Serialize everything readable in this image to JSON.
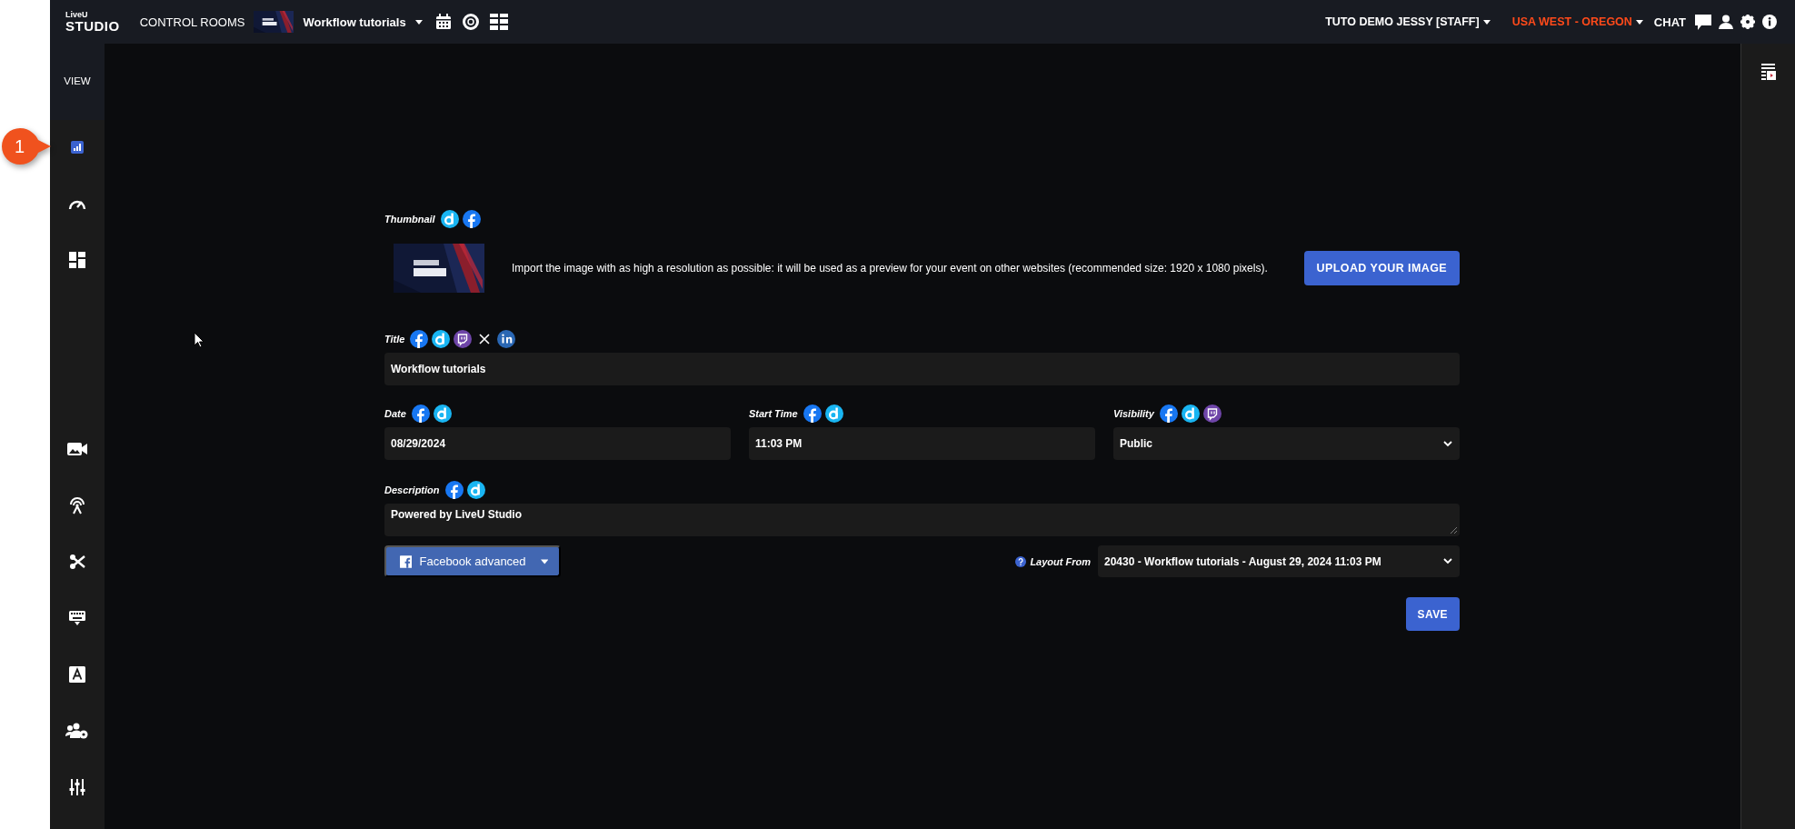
{
  "topbar": {
    "logo": {
      "top": "LiveU",
      "bottom": "STUDIO"
    },
    "nav_link": "CONTROL ROOMS",
    "room": {
      "name": "Workflow tutorials"
    },
    "user": "TUTO DEMO JESSY [STAFF]",
    "region": "USA WEST - OREGON",
    "chat": "CHAT"
  },
  "sidebar": {
    "header": "VIEW",
    "groups": [
      [
        {
          "kind": "chart",
          "selected": true
        },
        {
          "kind": "gauge",
          "selected": false
        },
        {
          "kind": "dashboard",
          "selected": false
        }
      ],
      [
        {
          "kind": "video",
          "selected": false
        },
        {
          "kind": "broadcast",
          "selected": false
        },
        {
          "kind": "scissors",
          "selected": false
        },
        {
          "kind": "keyboard",
          "selected": false
        },
        {
          "kind": "text",
          "selected": false
        },
        {
          "kind": "users",
          "selected": false
        },
        {
          "kind": "sliders",
          "selected": false
        }
      ]
    ]
  },
  "callout": {
    "label": "1"
  },
  "form": {
    "thumbnail": {
      "label": "Thumbnail",
      "platforms": [
        {
          "kind": "dailymotion"
        },
        {
          "kind": "facebook"
        }
      ],
      "hint": "Import the image with as high a resolution as possible: it will be used as a preview for your event on other websites (recommended size: 1920 x 1080 pixels).",
      "button": "UPLOAD YOUR IMAGE"
    },
    "title": {
      "label": "Title",
      "platforms": [
        {
          "kind": "facebook"
        },
        {
          "kind": "dailymotion"
        },
        {
          "kind": "twitch"
        },
        {
          "kind": "x"
        },
        {
          "kind": "linkedin"
        }
      ],
      "value": "Workflow tutorials"
    },
    "date": {
      "label": "Date",
      "platforms": [
        {
          "kind": "facebook"
        },
        {
          "kind": "dailymotion"
        }
      ],
      "value": "08/29/2024"
    },
    "start_time": {
      "label": "Start Time",
      "platforms": [
        {
          "kind": "facebook"
        },
        {
          "kind": "dailymotion"
        }
      ],
      "value": "11:03 PM"
    },
    "visibility": {
      "label": "Visibility",
      "platforms": [
        {
          "kind": "facebook"
        },
        {
          "kind": "dailymotion"
        },
        {
          "kind": "twitch"
        }
      ],
      "value": "Public"
    },
    "description": {
      "label": "Description",
      "platforms": [
        {
          "kind": "facebook"
        },
        {
          "kind": "dailymotion"
        }
      ],
      "value": "Powered by LiveU Studio"
    },
    "facebook_button": "Facebook advanced",
    "layout_from": {
      "label": "Layout From",
      "value": "20430 - Workflow tutorials - August 29, 2024 11:03 PM"
    },
    "save": "SAVE"
  }
}
